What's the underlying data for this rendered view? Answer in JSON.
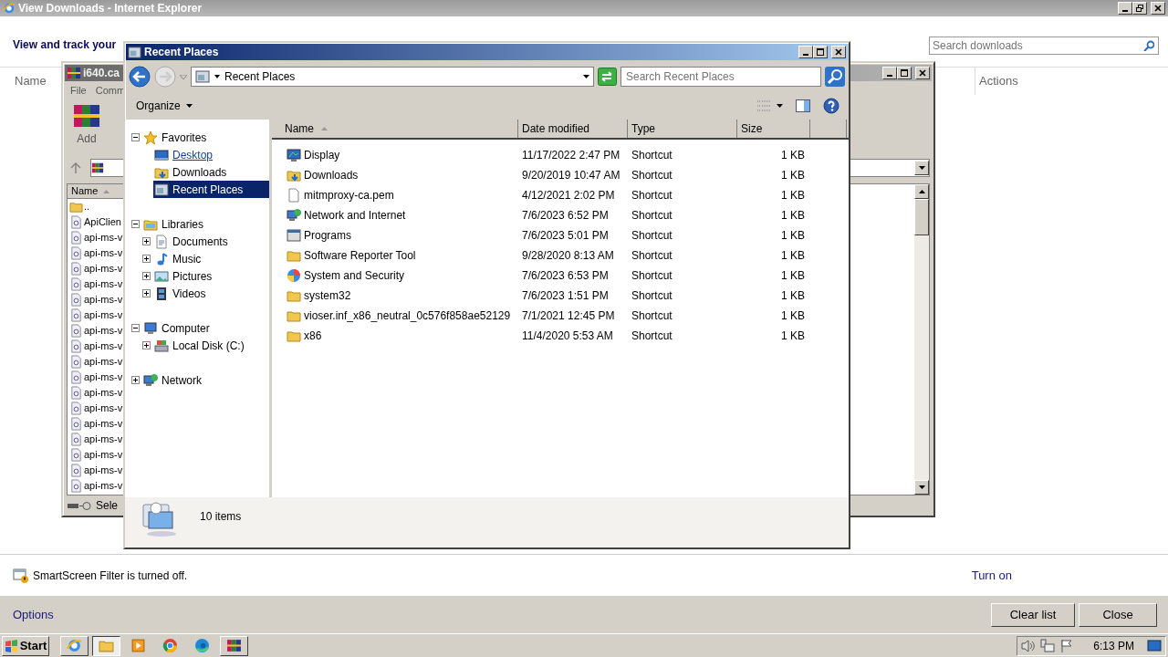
{
  "ie_window": {
    "title": "View Downloads - Internet Explorer",
    "heading": "View and track your",
    "search": {
      "placeholder": "Search downloads"
    },
    "columns": [
      "Name",
      "Actions"
    ],
    "notice": "SmartScreen Filter is turned off.",
    "notice_link": "Turn on",
    "options_link": "Options",
    "buttons": [
      "Clear list",
      "Close"
    ]
  },
  "archiver_window": {
    "title": "i640.ca",
    "menu": [
      "File",
      "Comm"
    ],
    "toolbar": [
      "Add"
    ],
    "column": {
      "label": "Name",
      "sorted": true
    },
    "rows": [
      {
        "name": "..",
        "kind": "folder"
      },
      {
        "name": "ApiClien",
        "kind": "file"
      },
      {
        "name": "api-ms-v",
        "kind": "file"
      },
      {
        "name": "api-ms-v",
        "kind": "file"
      },
      {
        "name": "api-ms-v",
        "kind": "file"
      },
      {
        "name": "api-ms-v",
        "kind": "file"
      },
      {
        "name": "api-ms-v",
        "kind": "file"
      },
      {
        "name": "api-ms-v",
        "kind": "file"
      },
      {
        "name": "api-ms-v",
        "kind": "file"
      },
      {
        "name": "api-ms-v",
        "kind": "file"
      },
      {
        "name": "api-ms-v",
        "kind": "file"
      },
      {
        "name": "api-ms-v",
        "kind": "file"
      },
      {
        "name": "api-ms-v",
        "kind": "file"
      },
      {
        "name": "api-ms-v",
        "kind": "file"
      },
      {
        "name": "api-ms-v",
        "kind": "file"
      },
      {
        "name": "api-ms-v",
        "kind": "file"
      },
      {
        "name": "api-ms-v",
        "kind": "file"
      },
      {
        "name": "api-ms-v",
        "kind": "file"
      },
      {
        "name": "api-ms-v",
        "kind": "file"
      }
    ],
    "status": "Sele"
  },
  "explorer_window": {
    "title": "Recent Places",
    "address": "Recent Places",
    "search": {
      "placeholder": "Search Recent Places"
    },
    "organize": "Organize",
    "tree": [
      {
        "label": "Favorites",
        "kind": "star",
        "expanded": true,
        "children": [
          {
            "label": "Desktop",
            "kind": "desktop",
            "selected": false,
            "hovered": true
          },
          {
            "label": "Downloads",
            "kind": "download-folder",
            "selected": false,
            "hovered": false
          },
          {
            "label": "Recent Places",
            "kind": "recent",
            "selected": true,
            "hovered": false
          }
        ]
      },
      {
        "label": "Libraries",
        "kind": "library",
        "expanded": true,
        "children": [
          {
            "label": "Documents",
            "kind": "document",
            "expanded": false
          },
          {
            "label": "Music",
            "kind": "music",
            "expanded": false
          },
          {
            "label": "Pictures",
            "kind": "pictures",
            "expanded": false
          },
          {
            "label": "Videos",
            "kind": "videos",
            "expanded": false
          }
        ]
      },
      {
        "label": "Computer",
        "kind": "computer",
        "expanded": true,
        "children": [
          {
            "label": "Local Disk (C:)",
            "kind": "disk",
            "expanded": false
          }
        ]
      },
      {
        "label": "Network",
        "kind": "network",
        "expanded": false
      }
    ],
    "columns": [
      {
        "label": "Name",
        "sorted": true
      },
      {
        "label": "Date modified",
        "sorted": false
      },
      {
        "label": "Type",
        "sorted": false
      },
      {
        "label": "Size",
        "sorted": false
      }
    ],
    "files": [
      {
        "name": "Display",
        "date": "11/17/2022 2:47 PM",
        "type": "Shortcut",
        "size": "1 KB",
        "kind": "display"
      },
      {
        "name": "Downloads",
        "date": "9/20/2019 10:47 AM",
        "type": "Shortcut",
        "size": "1 KB",
        "kind": "download-folder"
      },
      {
        "name": "mitmproxy-ca.pem",
        "date": "4/12/2021 2:02 PM",
        "type": "Shortcut",
        "size": "1 KB",
        "kind": "file"
      },
      {
        "name": "Network and Internet",
        "date": "7/6/2023 6:52 PM",
        "type": "Shortcut",
        "size": "1 KB",
        "kind": "network"
      },
      {
        "name": "Programs",
        "date": "7/6/2023 5:01 PM",
        "type": "Shortcut",
        "size": "1 KB",
        "kind": "programs"
      },
      {
        "name": "Software Reporter Tool",
        "date": "9/28/2020 8:13 AM",
        "type": "Shortcut",
        "size": "1 KB",
        "kind": "folder"
      },
      {
        "name": "System and Security",
        "date": "7/6/2023 6:53 PM",
        "type": "Shortcut",
        "size": "1 KB",
        "kind": "security"
      },
      {
        "name": "system32",
        "date": "7/6/2023 1:51 PM",
        "type": "Shortcut",
        "size": "1 KB",
        "kind": "folder"
      },
      {
        "name": "vioser.inf_x86_neutral_0c576f858ae52129",
        "date": "7/1/2021 12:45 PM",
        "type": "Shortcut",
        "size": "1 KB",
        "kind": "folder"
      },
      {
        "name": "x86",
        "date": "11/4/2020 5:53 AM",
        "type": "Shortcut",
        "size": "1 KB",
        "kind": "folder"
      }
    ],
    "status": "10 items"
  },
  "taskbar": {
    "start": "Start",
    "apps": [
      {
        "kind": "ie",
        "selected": false
      },
      {
        "kind": "folder",
        "selected": true
      },
      {
        "kind": "media",
        "selected": false
      },
      {
        "kind": "chrome",
        "selected": false
      },
      {
        "kind": "edge",
        "selected": false
      },
      {
        "kind": "archive",
        "selected": false
      }
    ],
    "clock": "6:13 PM"
  }
}
